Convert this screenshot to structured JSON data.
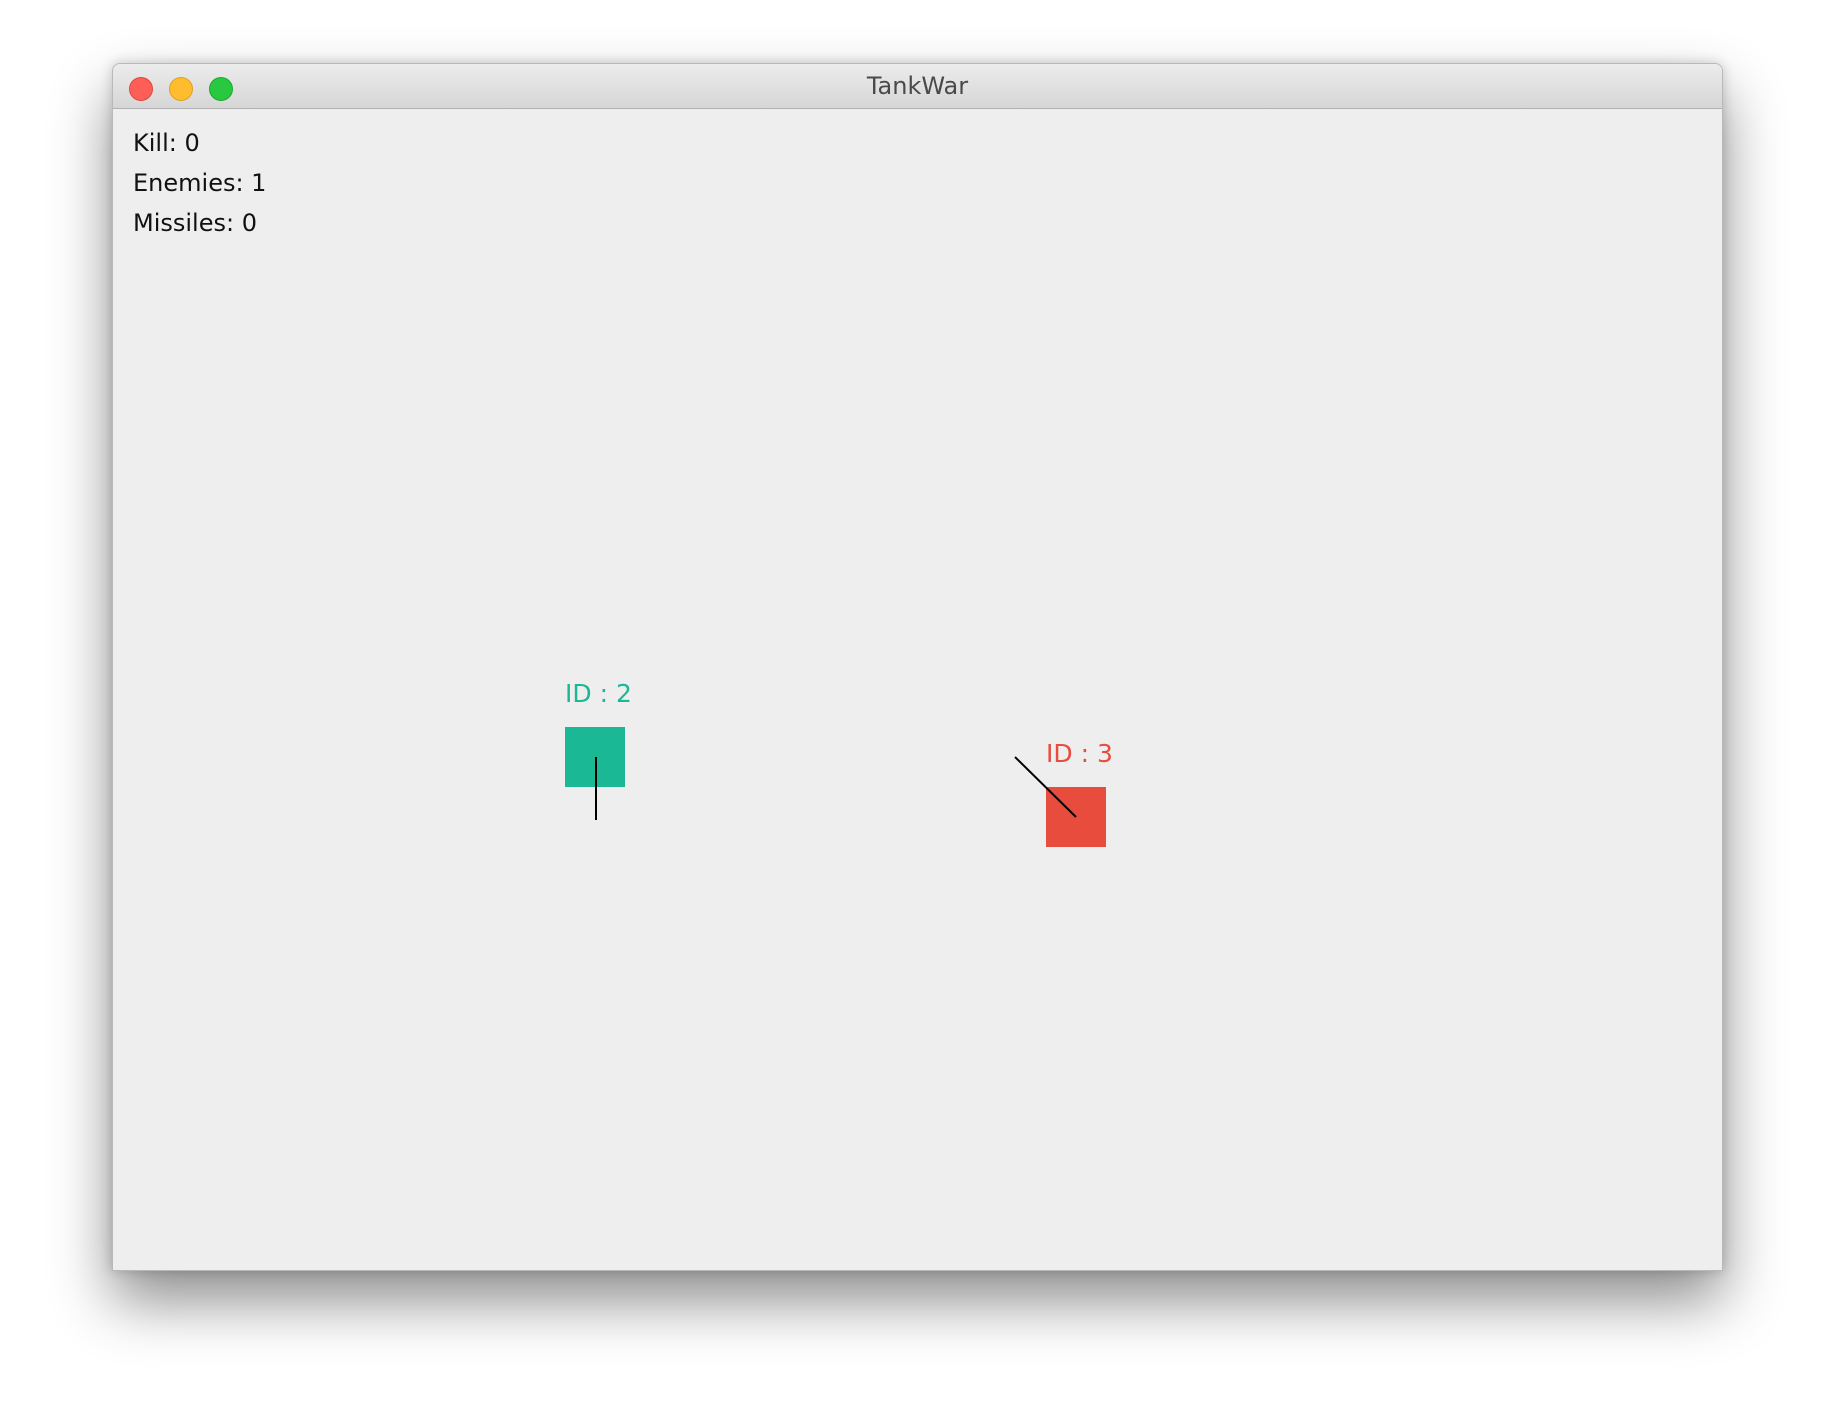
{
  "window": {
    "title": "TankWar"
  },
  "hud": {
    "kill": "Kill: 0",
    "enemies": "Enemies: 1",
    "missiles": "Missiles: 0"
  },
  "tanks": {
    "player": {
      "label": "ID : 2",
      "color": "#1bb896",
      "barrel_direction": "down"
    },
    "enemy": {
      "label": "ID : 3",
      "color": "#e84c3d",
      "barrel_direction": "up-left"
    }
  },
  "colors": {
    "background": "#eeeeee",
    "barrel": "#000000"
  }
}
